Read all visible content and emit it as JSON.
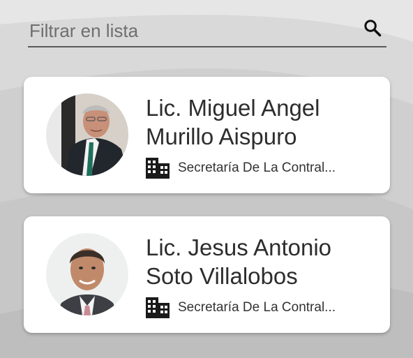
{
  "search": {
    "placeholder": "Filtrar en lista",
    "value": ""
  },
  "icons": {
    "search": "search-icon",
    "building": "building-icon"
  },
  "people": [
    {
      "name": "Lic. Miguel Angel Murillo Aispuro",
      "organization": "Secretaría De La Contral..."
    },
    {
      "name": "Lic. Jesus Antonio Soto Villalobos",
      "organization": "Secretaría De La Contral..."
    }
  ]
}
